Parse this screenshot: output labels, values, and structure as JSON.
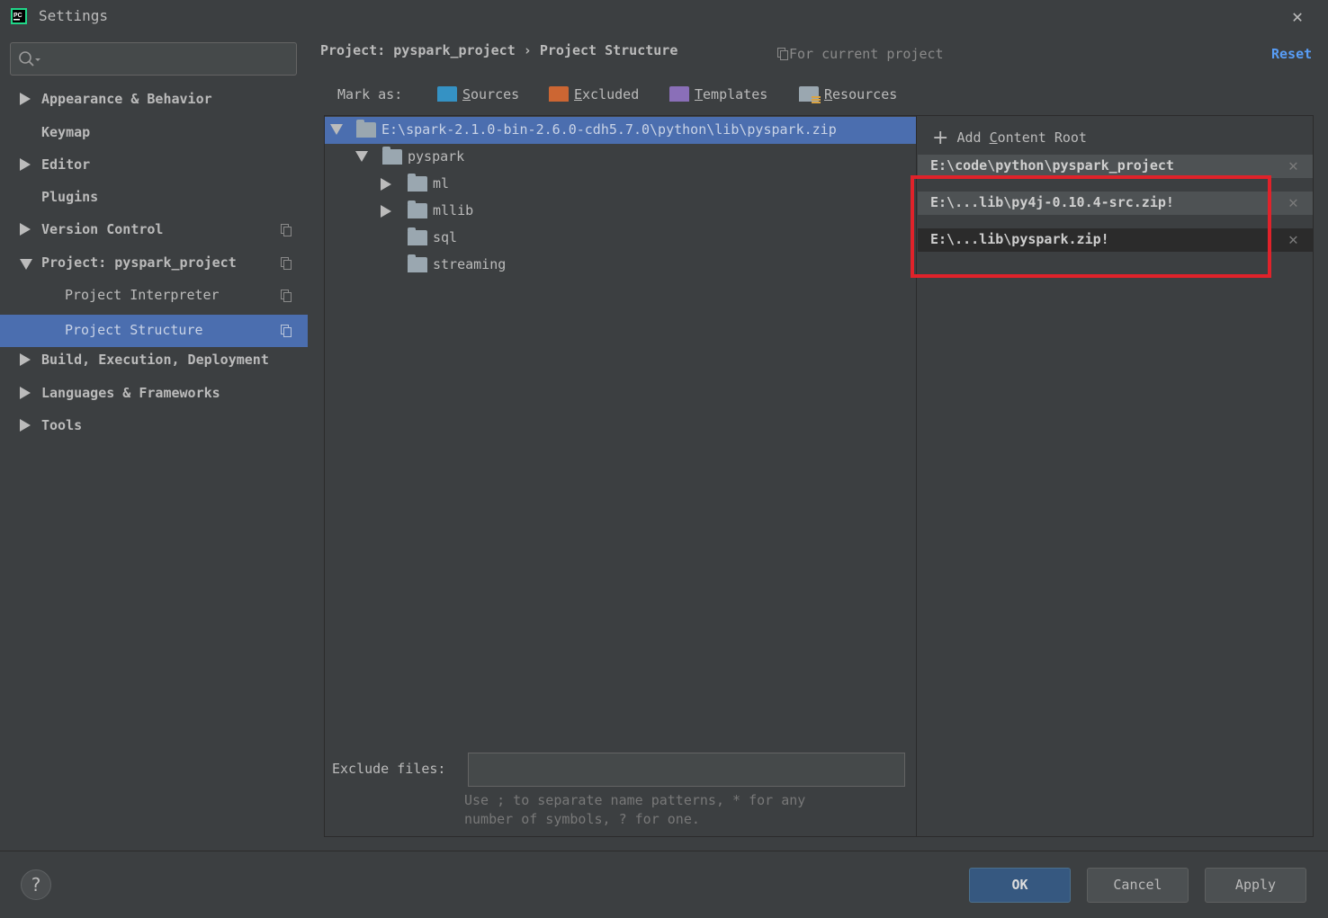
{
  "window": {
    "title": "Settings",
    "close": "✕"
  },
  "sidebar": {
    "search_placeholder": "",
    "items": [
      {
        "label": "Appearance & Behavior"
      },
      {
        "label": "Keymap"
      },
      {
        "label": "Editor"
      },
      {
        "label": "Plugins"
      },
      {
        "label": "Version Control"
      },
      {
        "label": "Project: pyspark_project"
      },
      {
        "label": "Project Interpreter"
      },
      {
        "label": "Project Structure"
      },
      {
        "label": "Build, Execution, Deployment"
      },
      {
        "label": "Languages & Frameworks"
      },
      {
        "label": "Tools"
      }
    ]
  },
  "header": {
    "breadcrumb": "Project: pyspark_project › Project Structure",
    "scope": "For current project",
    "reset": "Reset"
  },
  "mark_as": {
    "label": "Mark as:",
    "buttons": [
      {
        "prefix": "",
        "mnemonic": "S",
        "rest": "ources",
        "color": "#3592c4"
      },
      {
        "prefix": "",
        "mnemonic": "E",
        "rest": "xcluded",
        "color": "#cc6633"
      },
      {
        "prefix": "",
        "mnemonic": "T",
        "rest": "emplates",
        "color": "#8a6fb8"
      },
      {
        "prefix": "",
        "mnemonic": "R",
        "rest": "esources",
        "color": "#9aa7b0"
      }
    ]
  },
  "tree": {
    "root": "E:\\spark-2.1.0-bin-2.6.0-cdh5.7.0\\python\\lib\\pyspark.zip",
    "children": [
      "pyspark",
      "ml",
      "mllib",
      "sql",
      "streaming"
    ]
  },
  "exclude": {
    "label": "Exclude files:",
    "value": "",
    "hint_line1": "Use ; to separate name patterns, * for any",
    "hint_line2": "number of symbols, ? for one."
  },
  "roots": {
    "add_prefix": "Add ",
    "add_mnemonic": "C",
    "add_rest": "ontent Root",
    "items": [
      "E:\\code\\python\\pyspark_project",
      "E:\\...lib\\py4j-0.10.4-src.zip!",
      "E:\\...lib\\pyspark.zip!"
    ],
    "remove": "✕"
  },
  "footer": {
    "help": "?",
    "ok": "OK",
    "cancel": "Cancel",
    "apply": "Apply"
  },
  "colors": {
    "background": "#3c3f41",
    "selection": "#4b6eaf",
    "link": "#589df6",
    "highlight_box": "#e0222a",
    "primary_button": "#365880"
  }
}
